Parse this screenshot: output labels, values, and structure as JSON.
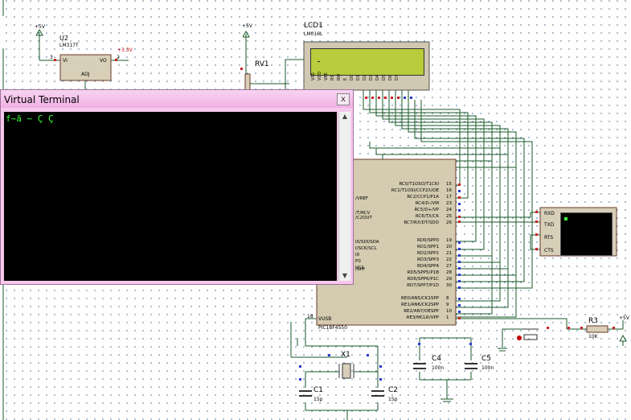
{
  "virtual_terminal": {
    "title": "Virtual Terminal",
    "close_label": "x",
    "output_text": "f~ã ~ Ç Ç"
  },
  "lcd": {
    "name": "LCD1",
    "part": "LM016L",
    "display_text": "-"
  },
  "regulator": {
    "name": "U2",
    "part": "LM317T",
    "pin_vi": "VI",
    "pin_vo": "VO",
    "pin_adj": "ADJ",
    "pin3": "3",
    "pin2": "2",
    "output_label": "+3.3V"
  },
  "power_labels": {
    "u2_supply": "+5V",
    "rv1_supply": "+5V",
    "r3_supply": "+5V"
  },
  "rv1": {
    "name": "RV1"
  },
  "lcd_pins": [
    "VSS",
    "VDD",
    "VEE",
    "RS",
    "RW",
    "E",
    "D0",
    "D1",
    "D2",
    "D3",
    "D4",
    "D5",
    "D6",
    "D7"
  ],
  "mcu": {
    "part": "PIC18F4550",
    "right_pins": [
      {
        "label": "RC0/T1OSO/T1CKI",
        "num": "15"
      },
      {
        "label": "RC1/T1OSI/CCP2/UOE",
        "num": "16"
      },
      {
        "label": "RC2/CCP1/P1A",
        "num": "17"
      },
      {
        "label": "RC4/D-/VM",
        "num": "23"
      },
      {
        "label": "RC5/D+/VP",
        "num": "24"
      },
      {
        "label": "RC6/TX/CK",
        "num": "25"
      },
      {
        "label": "RC7/RX/DT/SDO",
        "num": "26"
      },
      {
        "label": "RD0/SPP0",
        "num": "19"
      },
      {
        "label": "RD1/SPP1",
        "num": "20"
      },
      {
        "label": "RD2/SPP2",
        "num": "21"
      },
      {
        "label": "RD3/SPP3",
        "num": "22"
      },
      {
        "label": "RD4/SPP4",
        "num": "27"
      },
      {
        "label": "RD5/SPP5/P1B",
        "num": "28"
      },
      {
        "label": "RD6/SPP6/P1C",
        "num": "29"
      },
      {
        "label": "RD7/SPP7/P1D",
        "num": "30"
      },
      {
        "label": "RE0/AN5/CK1SPP",
        "num": "8"
      },
      {
        "label": "RE1/AN6/CK2SPP",
        "num": "9"
      },
      {
        "label": "RE2/AN7/OESPP",
        "num": "10"
      },
      {
        "label": "RE3/MCLR/VPP",
        "num": "1"
      }
    ],
    "left_labels": [
      "/VREF",
      "/T/RCV",
      "/C2OUT",
      "I0/SDI/SDA",
      "I/SCK/SCL",
      "I0",
      "P0",
      "I/C1",
      "/SPP"
    ],
    "vusb_label": "VUSB",
    "vusb_pin": "18"
  },
  "terminal2_pins": [
    "RXD",
    "TXD",
    "RTS",
    "CTS"
  ],
  "crystal": {
    "name": "X1"
  },
  "capacitors": [
    {
      "name": "C1",
      "value": "15p"
    },
    {
      "name": "C2",
      "value": "15p"
    },
    {
      "name": "C4",
      "value": "100n"
    },
    {
      "name": "C5",
      "value": "100n"
    }
  ],
  "resistor_r3": {
    "name": "R3",
    "value": "10K"
  }
}
